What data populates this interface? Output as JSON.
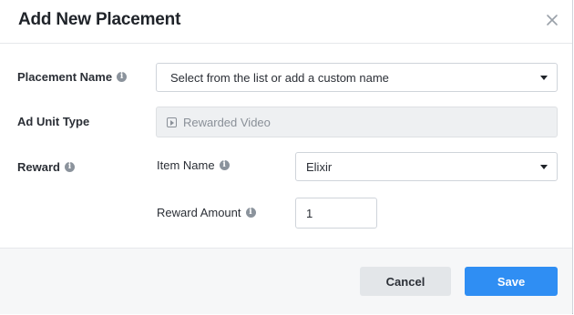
{
  "dialog": {
    "title": "Add New Placement",
    "close_icon": "close-icon"
  },
  "placement_name": {
    "label": "Placement Name",
    "info_icon": "info-icon",
    "select_placeholder": "Select from the list or add a custom name"
  },
  "ad_unit_type": {
    "label": "Ad Unit Type",
    "icon": "play-icon",
    "value": "Rewarded Video"
  },
  "reward": {
    "label": "Reward",
    "info_icon": "info-icon",
    "item_name": {
      "label": "Item Name",
      "value": "Elixir"
    },
    "reward_amount": {
      "label": "Reward Amount",
      "value": "1"
    }
  },
  "footer": {
    "cancel_label": "Cancel",
    "save_label": "Save"
  },
  "colors": {
    "primary": "#2f8ef3",
    "secondary_button": "#e3e6e9",
    "footer_background": "#f6f7f8"
  }
}
